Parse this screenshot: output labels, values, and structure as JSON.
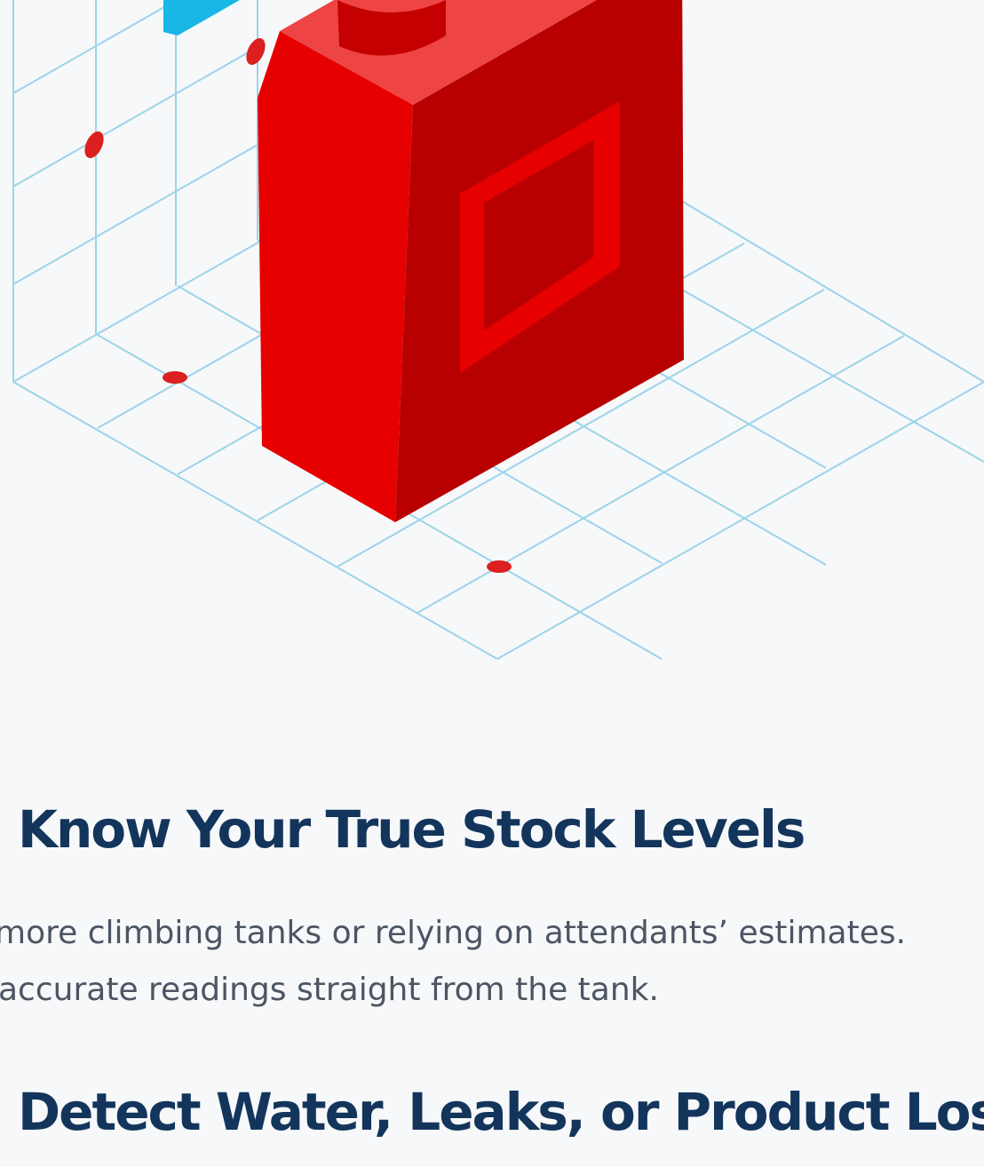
{
  "sections": [
    {
      "title": "Know Your True Stock Levels",
      "body_lines": [
        "more climbing tanks or relying on attendants’ estimates.",
        "accurate readings straight from the tank."
      ]
    },
    {
      "title": "Detect Water, Leaks, or Product Loss"
    }
  ],
  "illustration": {
    "icon": "fuel-jerry-can-icon",
    "colors": {
      "can_front": "#e60000",
      "can_side": "#b80000",
      "can_top": "#ef4444",
      "grid": "#9bd4ea",
      "accent_blue": "#18b7e6",
      "dots": "#dc1f1f"
    }
  }
}
